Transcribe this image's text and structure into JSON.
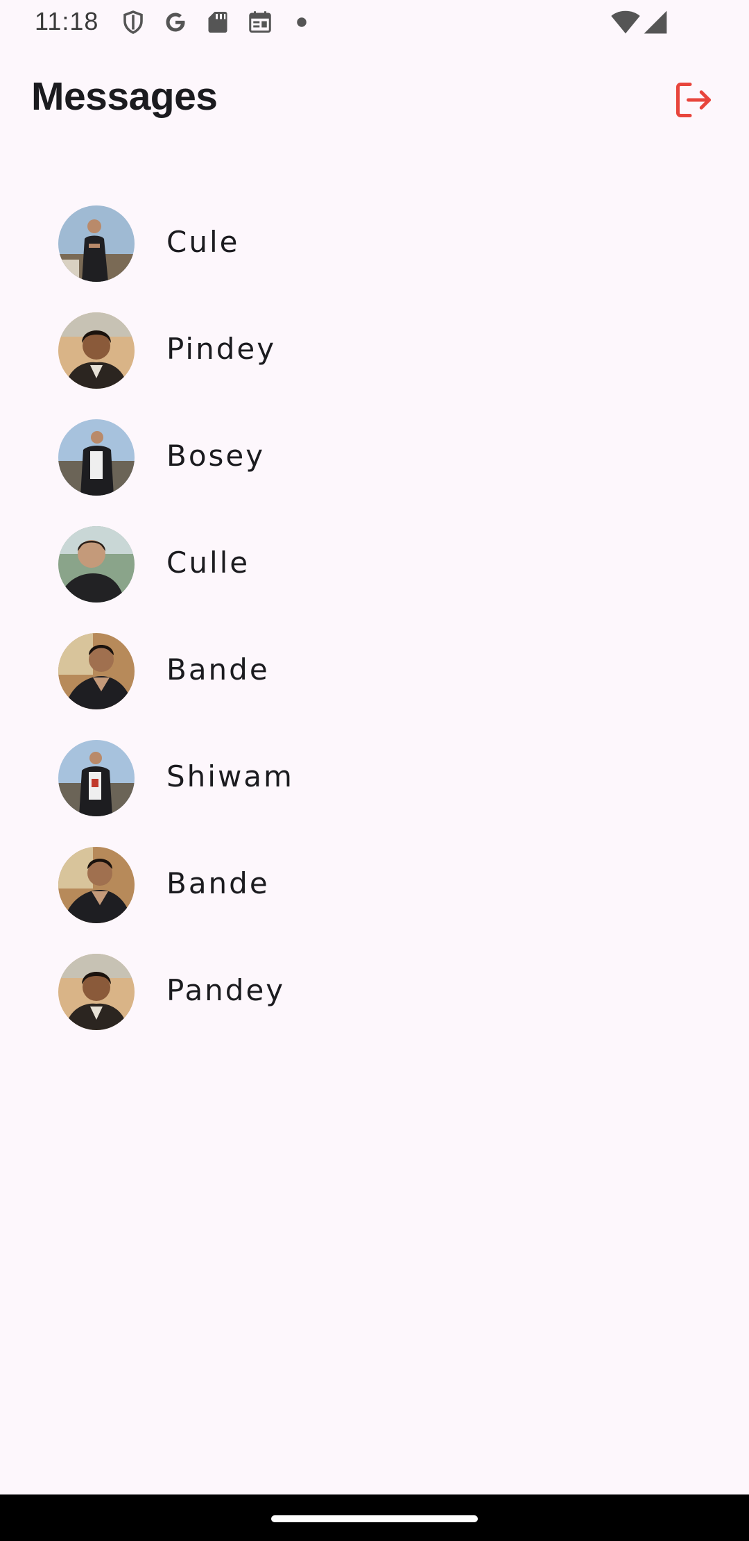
{
  "status_bar": {
    "time": "11:18",
    "icons": [
      "shield-icon",
      "google-icon",
      "sd-card-icon",
      "calendar-icon",
      "notification-dot-icon",
      "wifi-icon",
      "cellular-signal-icon"
    ]
  },
  "header": {
    "title": "Messages",
    "logout_icon": "logout-icon"
  },
  "colors": {
    "background": "#fdf7fc",
    "accent": "#e8453c",
    "text": "#1b1b1f"
  },
  "contacts": [
    {
      "name": "Cule",
      "avatar": "photo-avatar"
    },
    {
      "name": "Pindey",
      "avatar": "photo-avatar"
    },
    {
      "name": "Bosey",
      "avatar": "photo-avatar"
    },
    {
      "name": "Culle",
      "avatar": "photo-avatar"
    },
    {
      "name": "Bande",
      "avatar": "photo-avatar"
    },
    {
      "name": "Shiwam",
      "avatar": "photo-avatar"
    },
    {
      "name": "Bande",
      "avatar": "photo-avatar"
    },
    {
      "name": "Pandey",
      "avatar": "photo-avatar"
    }
  ]
}
